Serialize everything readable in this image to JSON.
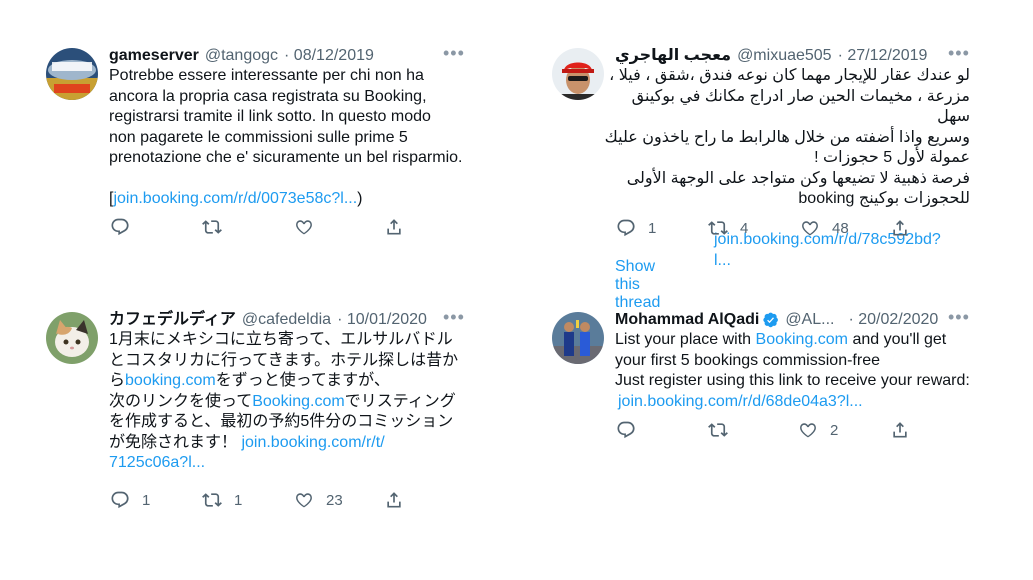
{
  "tweets": [
    {
      "name": "gameserver",
      "handle": "@tangogc",
      "date": "· 08/12/2019",
      "body_text": "Potrebbe essere interessante per chi non ha\nancora la propria casa registrata su Booking,\nregistrarsi tramite il link sotto. In questo modo\nnon pagarete le commissioni sulle prime 5\nprenotazione che e' sicuramente un bel risparmio.\n\n",
      "link_prefix": "[",
      "link": "join.booking.com/r/d/0073e58c?l...",
      "link_suffix": ")",
      "reply_count": "",
      "retweet_count": "",
      "like_count": ""
    },
    {
      "name": "معجب الهاجري",
      "handle": "@mixuae505",
      "date": "· 27/12/2019",
      "body_text": "لو عندك عقار للإيجار مهما كان نوعه فندق ،شقق ، فيلا ،\nمزرعة ، مخيمات الحين صار ادراج مكانك في بوكينق سهل\nوسريع واذا أضفته من خلال هالرابط ما راح ياخذون عليك\nعمولة لأول 5 حجوزات !\nفرصة ذهبية لا تضيعها وكن متواجد على الوجهة الأولى\nللحجوزات بوكينج booking",
      "link": "join.booking.com/r/d/78c592bd?l...",
      "reply_count": "1",
      "retweet_count": "4",
      "like_count": "48",
      "show_thread": "Show this thread"
    },
    {
      "name": "カフェデルディア",
      "handle": "@cafedeldia",
      "date": "· 10/01/2020",
      "line1": "1月末にメキシコに立ち寄って、エルサルバドル",
      "line2": "とコスタリカに行ってきます。ホテル探しは昔か",
      "line3a": "ら",
      "line3link": "booking.com",
      "line3b": "をずっと使ってますが、",
      "line4a": "次のリンクを使って",
      "line4link": "Booking.com",
      "line4b": "でリスティング",
      "line5": "を作成すると、最初の予約5件分のコミッション",
      "line6a": "が免除されます！ ",
      "line6link": "join.booking.com/r/t/",
      "line7link": "7125c06a?l...",
      "reply_count": "1",
      "retweet_count": "1",
      "like_count": "23"
    },
    {
      "name": "Mohammad AlQadi",
      "handle": "@AL...",
      "date": "· 20/02/2020",
      "line1a": "List your place with ",
      "line1link": "Booking.com",
      "line1b": " and you'll get",
      "line2": "your first 5 bookings commission-free",
      "line3": "Just register using this link to receive your reward:",
      "link": "join.booking.com/r/d/68de04a3?l...",
      "reply_count": "",
      "retweet_count": "",
      "like_count": "2"
    }
  ],
  "icons": {
    "more": "more-icon",
    "reply": "reply-icon",
    "retweet": "retweet-icon",
    "like": "like-icon",
    "share": "share-icon",
    "verified": "verified-badge-icon"
  },
  "colors": {
    "link": "#1d9bf0",
    "text": "#0f1419",
    "muted": "#536471"
  }
}
